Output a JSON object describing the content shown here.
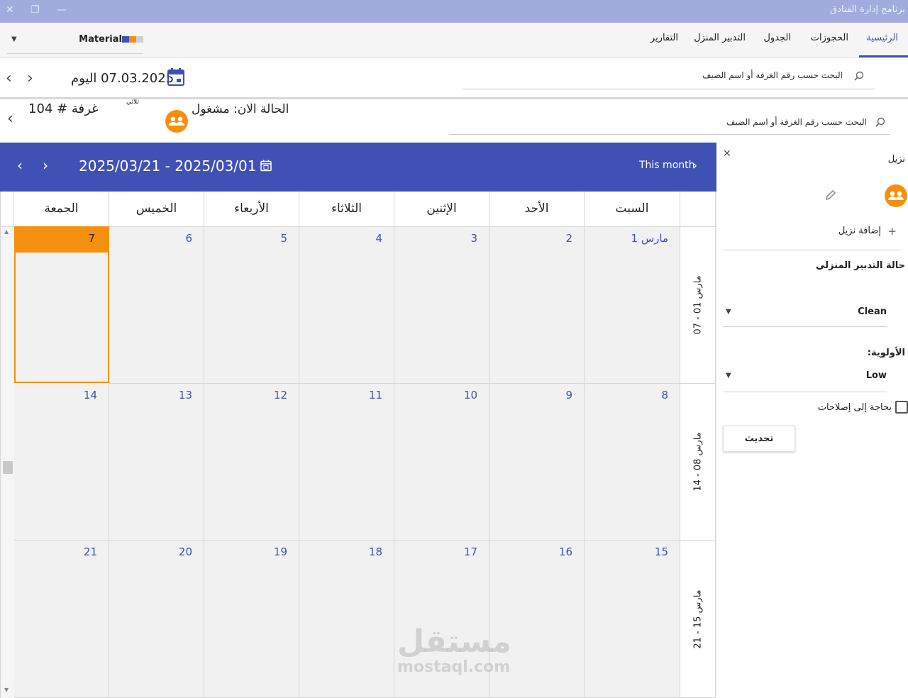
{
  "window": {
    "title": "برنامج إدارة الفنادق",
    "close_glyph": "✕",
    "restore_glyph": "❐",
    "minimize_glyph": "—"
  },
  "menubar": {
    "tabs": [
      {
        "label": "الرئيسية",
        "active": true
      },
      {
        "label": "الحجوزات"
      },
      {
        "label": "الجدول"
      },
      {
        "label": "التدبير المنزل"
      },
      {
        "label": "التقارير"
      }
    ],
    "theme_dropdown": {
      "value": "Material",
      "arrow": "▼"
    }
  },
  "toolbar": {
    "search_placeholder": "البحث حسب رقم الغرفة أو اسم الضيف",
    "date_value": "07.03.2025 اليوم",
    "prev": "‹",
    "next": "›"
  },
  "room": {
    "number_label": "غرفة # 104",
    "type": "ثلاثي",
    "status": "الحالة الان: مشغول",
    "search_placeholder": "البحث حسب رقم الغرفة أو اسم الضيف",
    "back": "‹"
  },
  "calendar": {
    "range": "2025/03/21 - 2025/03/01",
    "this_month": "This month",
    "day_headers": [
      "السبت",
      "الأحد",
      "الإثنين",
      "الثلاثاء",
      "الأربعاء",
      "الخميس",
      "الجمعة"
    ],
    "weeks": [
      {
        "label": "مارس 01 - 07",
        "days": [
          "مارس 1",
          "2",
          "3",
          "4",
          "5",
          "6",
          "7"
        ]
      },
      {
        "label": "مارس 08 - 14",
        "days": [
          "8",
          "9",
          "10",
          "11",
          "12",
          "13",
          "14"
        ]
      },
      {
        "label": "مارس 15 - 21",
        "days": [
          "15",
          "16",
          "17",
          "18",
          "19",
          "20",
          "21"
        ]
      }
    ],
    "today": "7"
  },
  "guest_panel": {
    "title": "نزيل",
    "close": "✕",
    "add_guest": "إضافة نزيل",
    "add_glyph": "+",
    "housekeeping_label": "حالة التدبير المنزلي",
    "housekeeping_value": "Clean",
    "priority_label": "الأولوية:",
    "priority_value": "Low",
    "repairs_label": "بحاجة إلى إصلاحات",
    "update_button": "تحديث",
    "dropdown_arrow": "▼"
  },
  "watermark": {
    "arabic": "مستقل",
    "latin": "mostaql.com"
  },
  "colors": {
    "accent": "#3f51b5",
    "orange": "#f5900f",
    "titlebar": "#a1acdd"
  }
}
